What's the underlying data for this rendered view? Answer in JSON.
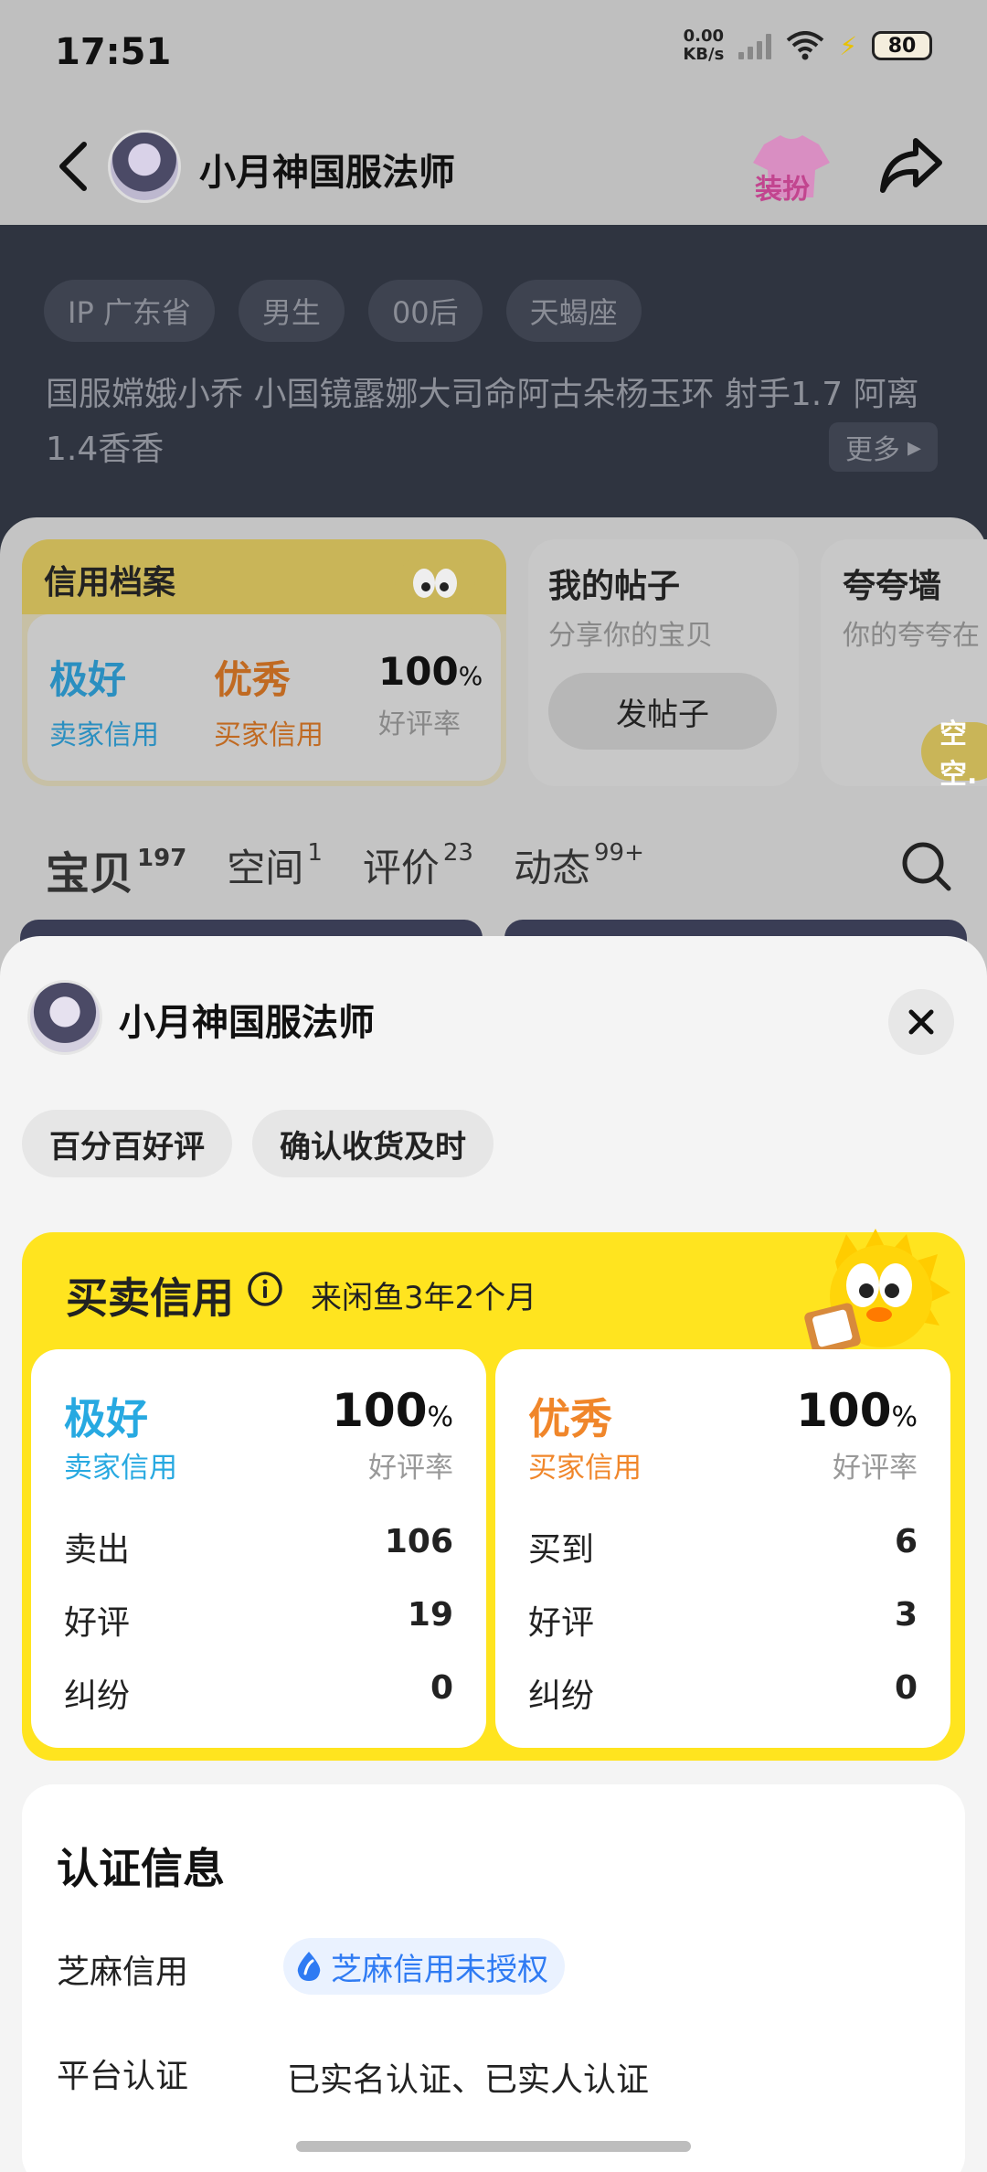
{
  "status": {
    "time": "17:51",
    "net_speed_value": "0.00",
    "net_speed_unit": "KB/s",
    "battery": "80"
  },
  "nav": {
    "title": "小月神国服法师",
    "dress_label": "装扮"
  },
  "profile": {
    "tags": [
      "IP 广东省",
      "男生",
      "00后",
      "天蝎座"
    ],
    "bio": "国服嫦娥小乔  小国镜露娜大司命阿古朵杨玉环  射手1.7 阿离 1.4香香",
    "more_label": "更多"
  },
  "cards": {
    "credit": {
      "title": "信用档案",
      "seller_grade": "极好",
      "seller_label": "卖家信用",
      "buyer_grade": "优秀",
      "buyer_label": "买家信用",
      "rate": "100",
      "rate_unit": "%",
      "rate_label": "好评率"
    },
    "posts": {
      "title": "我的帖子",
      "subtitle": "分享你的宝贝",
      "button": "发帖子"
    },
    "praise": {
      "title": "夸夸墙",
      "subtitle": "你的夸夸在",
      "bubble": "空空."
    }
  },
  "tabs": [
    {
      "label": "宝贝",
      "count": "197"
    },
    {
      "label": "空间",
      "count": "1"
    },
    {
      "label": "评价",
      "count": "23"
    },
    {
      "label": "动态",
      "count": "99+"
    }
  ],
  "sheet": {
    "name": "小月神国服法师",
    "chips": [
      "百分百好评",
      "确认收货及时"
    ],
    "credit_title": "买卖信用",
    "credit_since": "来闲鱼3年2个月",
    "seller": {
      "grade": "极好",
      "grade_label": "卖家信用",
      "rate": "100",
      "rate_unit": "%",
      "rate_label": "好评率",
      "rows": [
        {
          "label": "卖出",
          "value": "106"
        },
        {
          "label": "好评",
          "value": "19"
        },
        {
          "label": "纠纷",
          "value": "0"
        }
      ]
    },
    "buyer": {
      "grade": "优秀",
      "grade_label": "买家信用",
      "rate": "100",
      "rate_unit": "%",
      "rate_label": "好评率",
      "rows": [
        {
          "label": "买到",
          "value": "6"
        },
        {
          "label": "好评",
          "value": "3"
        },
        {
          "label": "纠纷",
          "value": "0"
        }
      ]
    },
    "auth": {
      "title": "认证信息",
      "zhima_label": "芝麻信用",
      "zhima_status": "芝麻信用未授权",
      "platform_label": "平台认证",
      "platform_value": "已实名认证、已实人认证"
    }
  },
  "colors": {
    "accent_yellow": "#ffe41f",
    "seller_blue": "#27a9e1",
    "buyer_orange": "#f0862a",
    "zhima_blue": "#2f7bf3"
  }
}
